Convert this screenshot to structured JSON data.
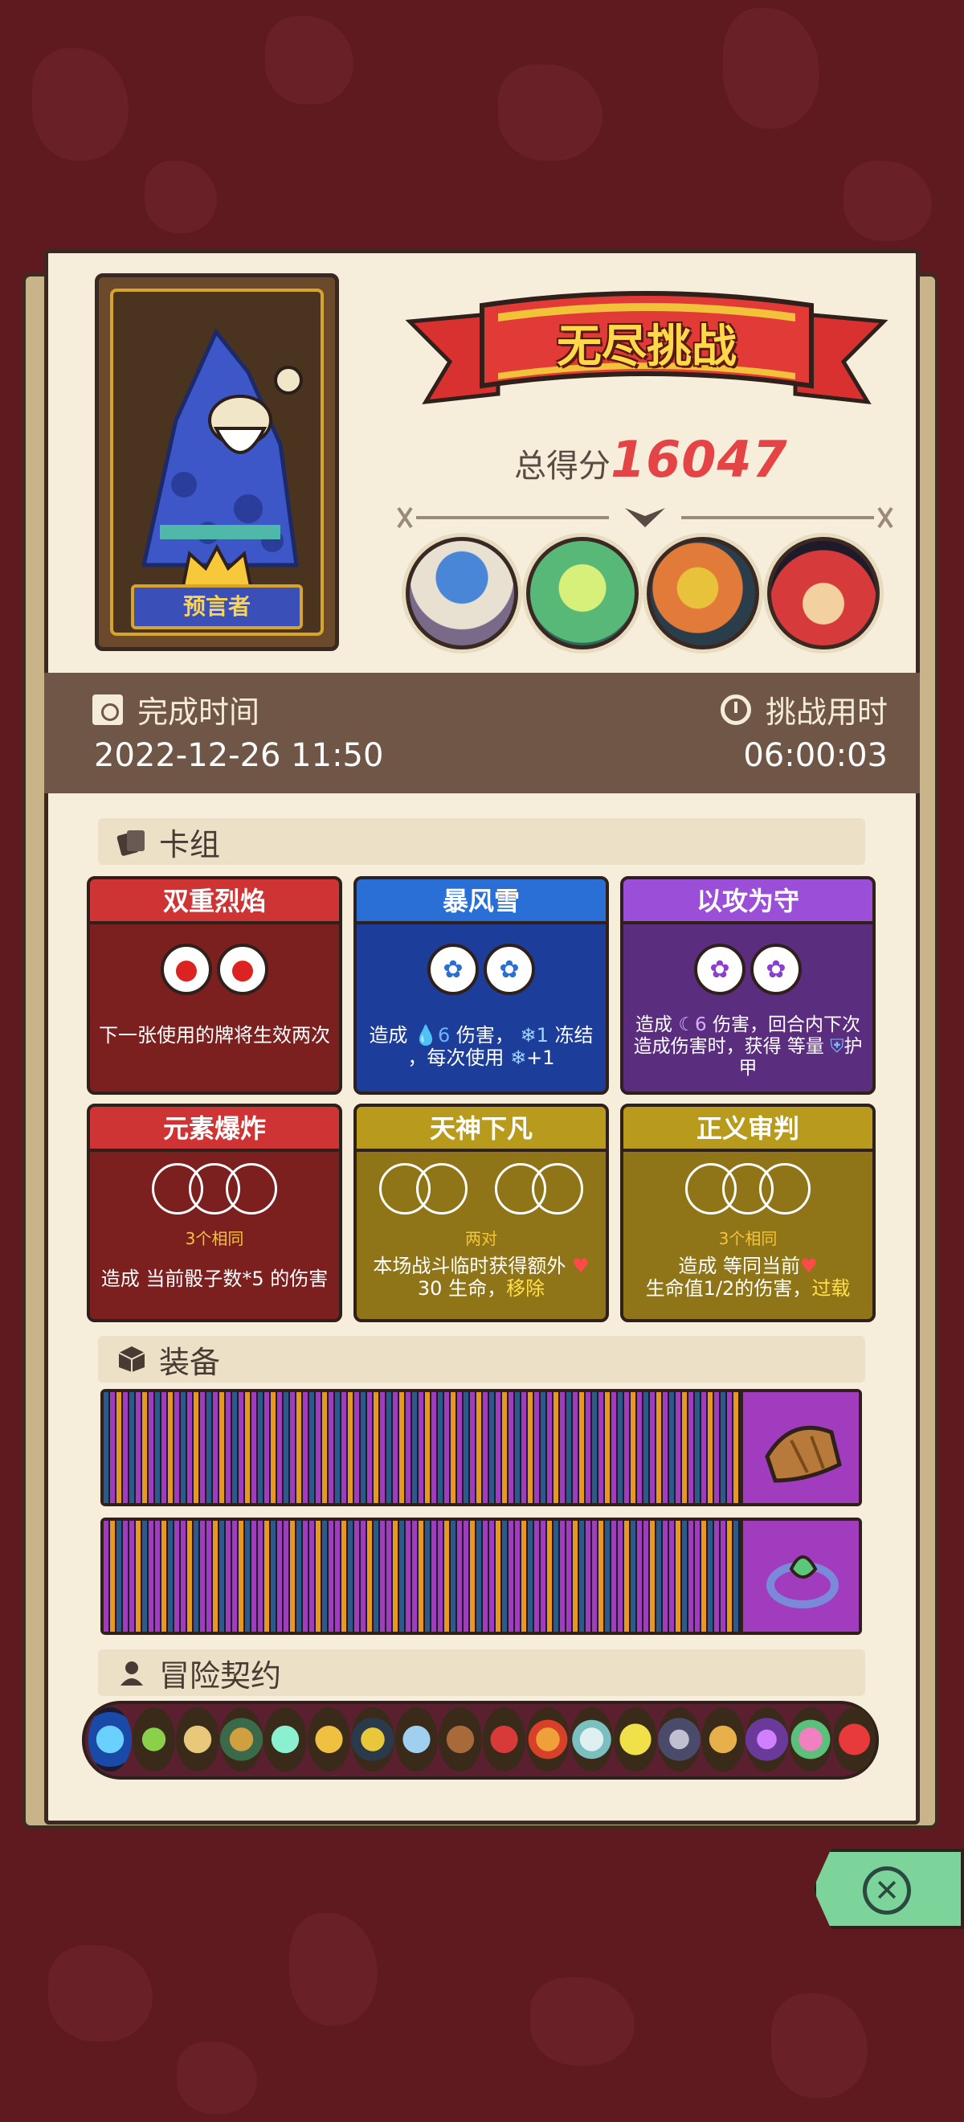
{
  "hero": {
    "name": "预言者"
  },
  "mode": {
    "title": "无尽挑战"
  },
  "score": {
    "label": "总得分",
    "value": "16047"
  },
  "info": {
    "finish_time_label": "完成时间",
    "finish_time_value": "2022-12-26 11:50",
    "duration_label": "挑战用时",
    "duration_value": "06:00:03"
  },
  "sections": {
    "deck": "卡组",
    "equipment": "装备",
    "contracts": "冒险契约"
  },
  "cards": [
    {
      "title": "双重烈焰",
      "desc": "下一张使用的牌将生效两次",
      "cond": ""
    },
    {
      "title": "暴风雪",
      "desc_a": "造成",
      "desc_b": "6",
      "desc_c": "伤害，",
      "desc_d": "1",
      "desc_e": "冻结",
      "desc_f": "，每次使用",
      "desc_g": "+1",
      "cond": ""
    },
    {
      "title": "以攻为守",
      "desc_a": "造成",
      "desc_b": "6",
      "desc_c": "伤害，回合内下次造成伤害时，获得 等量",
      "desc_d": "护甲",
      "cond": ""
    },
    {
      "title": "元素爆炸",
      "cond": "3个相同",
      "desc": "造成 当前骰子数*5 的伤害"
    },
    {
      "title": "天神下凡",
      "cond": "两对",
      "desc_a": "本场战斗临时获得额外",
      "desc_b": "30 生命，",
      "desc_c": "移除"
    },
    {
      "title": "正义审判",
      "cond": "3个相同",
      "desc_a": "造成 等同当前",
      "desc_b": "生命值1/2的伤害，",
      "desc_c": "过载"
    }
  ],
  "colors": {
    "score": "#e54446",
    "highlight": "#f5c53a",
    "panel": "#f6eedb",
    "band": "#6f5647"
  }
}
